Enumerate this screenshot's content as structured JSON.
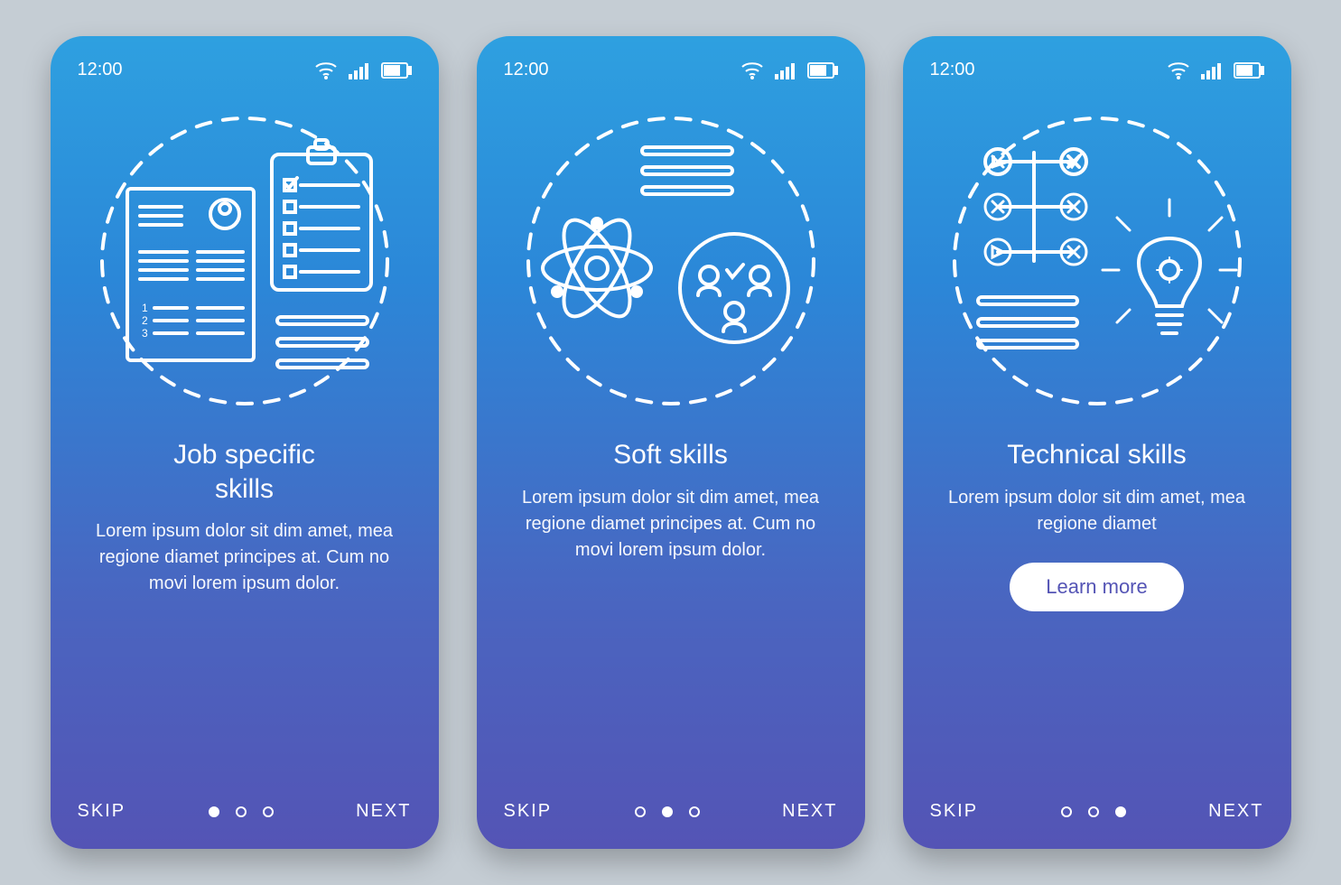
{
  "status": {
    "time": "12:00"
  },
  "footer": {
    "skip": "SKIP",
    "next": "NEXT"
  },
  "screens": [
    {
      "title": "Job specific\nskills",
      "desc": "Lorem ipsum dolor sit dim amet, mea regione diamet principes at. Cum no movi lorem ipsum dolor.",
      "activeDot": 0,
      "cta": null,
      "illustration": "resume-checklist-icon"
    },
    {
      "title": "Soft skills",
      "desc": "Lorem ipsum dolor sit dim amet, mea regione diamet principes at. Cum no movi lorem ipsum dolor.",
      "activeDot": 1,
      "cta": null,
      "illustration": "atom-team-icon"
    },
    {
      "title": "Technical skills",
      "desc": "Lorem ipsum dolor sit dim amet, mea regione diamet",
      "activeDot": 2,
      "cta": "Learn more",
      "illustration": "decision-idea-icon"
    }
  ],
  "colors": {
    "gradientTop": "#2ea0e0",
    "gradientBottom": "#5454b5",
    "page": "#c5cdd4"
  }
}
